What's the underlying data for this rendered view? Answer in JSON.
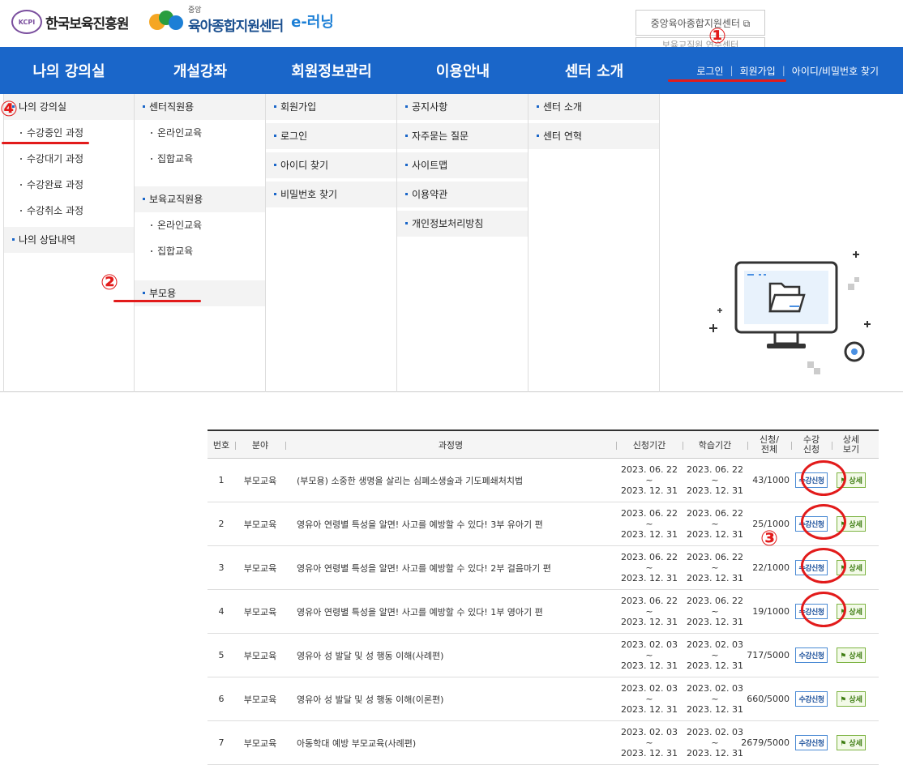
{
  "header": {
    "logo1": {
      "badge": "KCPI",
      "text": "한국보육진흥원"
    },
    "logo2": {
      "small": "중앙",
      "big": "육아종합지원센터",
      "elearning": "e-러닝"
    },
    "center_link": "중앙육아종합지원센터 ⧉",
    "center_link2": "보육교직원 연수센터"
  },
  "nav": {
    "items": [
      "나의 강의실",
      "개설강좌",
      "회원정보관리",
      "이용안내",
      "센터 소개"
    ],
    "links": [
      "로그인",
      "회원가입",
      "아이디/비밀번호 찾기"
    ]
  },
  "mega": {
    "col1": {
      "sec1": "나의 강의실",
      "subs": [
        "수강중인 과정",
        "수강대기 과정",
        "수강완료 과정",
        "수강취소 과정"
      ],
      "sec2": "나의 상담내역"
    },
    "col2": {
      "sec1": "센터직원용",
      "subs1": [
        "온라인교육",
        "집합교육"
      ],
      "sec2": "보육교직원용",
      "subs2": [
        "온라인교육",
        "집합교육"
      ],
      "sec3": "부모용"
    },
    "col3": {
      "secs": [
        "회원가입",
        "로그인",
        "아이디 찾기",
        "비밀번호 찾기"
      ]
    },
    "col4": {
      "secs": [
        "공지사항",
        "자주묻는 질문",
        "사이트맵",
        "이용약관",
        "개인정보처리방침"
      ]
    },
    "col5": {
      "secs": [
        "센터 소개",
        "센터 연혁"
      ]
    }
  },
  "annotations": [
    "①",
    "②",
    "③",
    "④"
  ],
  "table": {
    "headers": [
      "번호",
      "분야",
      "과정명",
      "신청기간",
      "학습기간",
      "신청/\n전체",
      "수강\n신청",
      "상세\n보기"
    ],
    "apply_label": "수강신청",
    "detail_label": "상세",
    "tilde": "~",
    "rows": [
      {
        "no": "1",
        "field": "부모교육",
        "title": "(부모용) 소중한 생명을 살리는 심폐소생술과 기도폐쇄처치법",
        "apply_start": "2023. 06. 22",
        "apply_end": "2023. 12. 31",
        "study_start": "2023. 06. 22",
        "study_end": "2023. 12. 31",
        "count": "43/1000"
      },
      {
        "no": "2",
        "field": "부모교육",
        "title": "영유아 연령별 특성을 알면! 사고를 예방할 수 있다! 3부 유아기 편",
        "apply_start": "2023. 06. 22",
        "apply_end": "2023. 12. 31",
        "study_start": "2023. 06. 22",
        "study_end": "2023. 12. 31",
        "count": "25/1000"
      },
      {
        "no": "3",
        "field": "부모교육",
        "title": "영유아 연령별 특성을 알면! 사고를 예방할 수 있다! 2부 걸음마기 편",
        "apply_start": "2023. 06. 22",
        "apply_end": "2023. 12. 31",
        "study_start": "2023. 06. 22",
        "study_end": "2023. 12. 31",
        "count": "22/1000"
      },
      {
        "no": "4",
        "field": "부모교육",
        "title": "영유아 연령별 특성을 알면! 사고를 예방할 수 있다! 1부 영아기 편",
        "apply_start": "2023. 06. 22",
        "apply_end": "2023. 12. 31",
        "study_start": "2023. 06. 22",
        "study_end": "2023. 12. 31",
        "count": "19/1000"
      },
      {
        "no": "5",
        "field": "부모교육",
        "title": "영유아 성 발달 및 성 행동 이해(사례편)",
        "apply_start": "2023. 02. 03",
        "apply_end": "2023. 12. 31",
        "study_start": "2023. 02. 03",
        "study_end": "2023. 12. 31",
        "count": "717/5000"
      },
      {
        "no": "6",
        "field": "부모교육",
        "title": "영유아 성 발달 및 성 행동 이해(이론편)",
        "apply_start": "2023. 02. 03",
        "apply_end": "2023. 12. 31",
        "study_start": "2023. 02. 03",
        "study_end": "2023. 12. 31",
        "count": "660/5000"
      },
      {
        "no": "7",
        "field": "부모교육",
        "title": "아동학대 예방 부모교육(사례편)",
        "apply_start": "2023. 02. 03",
        "apply_end": "2023. 12. 31",
        "study_start": "2023. 02. 03",
        "study_end": "2023. 12. 31",
        "count": "2679/5000"
      }
    ]
  }
}
